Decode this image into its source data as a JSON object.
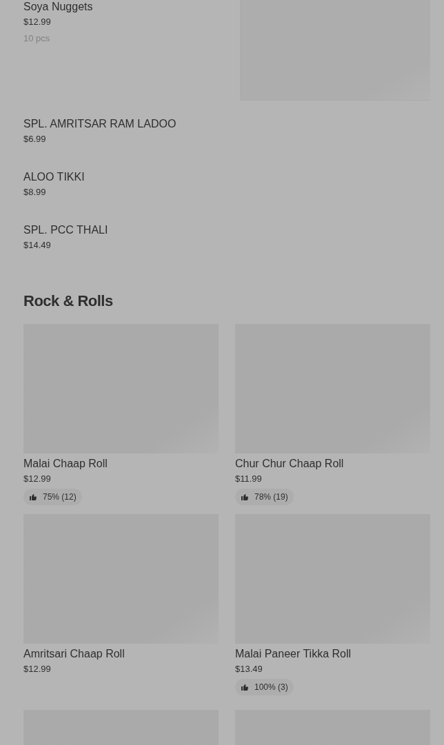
{
  "featured_item": {
    "name": "Soya Nuggets",
    "price": "$12.99",
    "note": "10 pcs",
    "image": {
      "kind": "picture"
    }
  },
  "simple_items": [
    {
      "name": "SPL. AMRITSAR RAM LADOO",
      "price": "$6.99"
    },
    {
      "name": "ALOO TIKKI",
      "price": "$8.99"
    },
    {
      "name": "SPL. PCC THALI",
      "price": "$14.49"
    }
  ],
  "section": {
    "title": "Rock & Rolls",
    "items": [
      {
        "name": "Malai Chaap Roll",
        "price": "$12.99",
        "rating": "75% (12)"
      },
      {
        "name": "Chur Chur Chaap Roll",
        "price": "$11.99",
        "rating": "78% (19)"
      },
      {
        "name": "Amritsari Chaap Roll",
        "price": "$12.99"
      },
      {
        "name": "Malai Paneer Tikka Roll",
        "price": "$13.49",
        "rating": "100% (3)"
      },
      {
        "image": {
          "kind": "picture"
        }
      },
      {
        "image": {
          "kind": "picture"
        }
      }
    ]
  }
}
